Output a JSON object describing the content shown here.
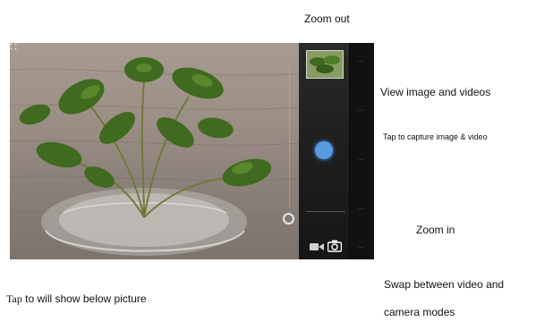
{
  "annotations": {
    "zoom_out": "Zoom out",
    "view_media": "View image and videos",
    "capture": "Tap to capture image & video",
    "zoom_in": "Zoom in",
    "swap_modes_line1": "Swap between video and",
    "swap_modes_line2": "camera modes",
    "tap_preview_prefix": "Tap",
    "tap_preview_rest": " to will show below picture"
  },
  "camera": {
    "shutter_color": "#5b9ae0",
    "current_mode": "camera",
    "icons": [
      "video-camera-icon",
      "camera-icon",
      "shutter-button",
      "zoom-knob",
      "grid-icon"
    ]
  }
}
